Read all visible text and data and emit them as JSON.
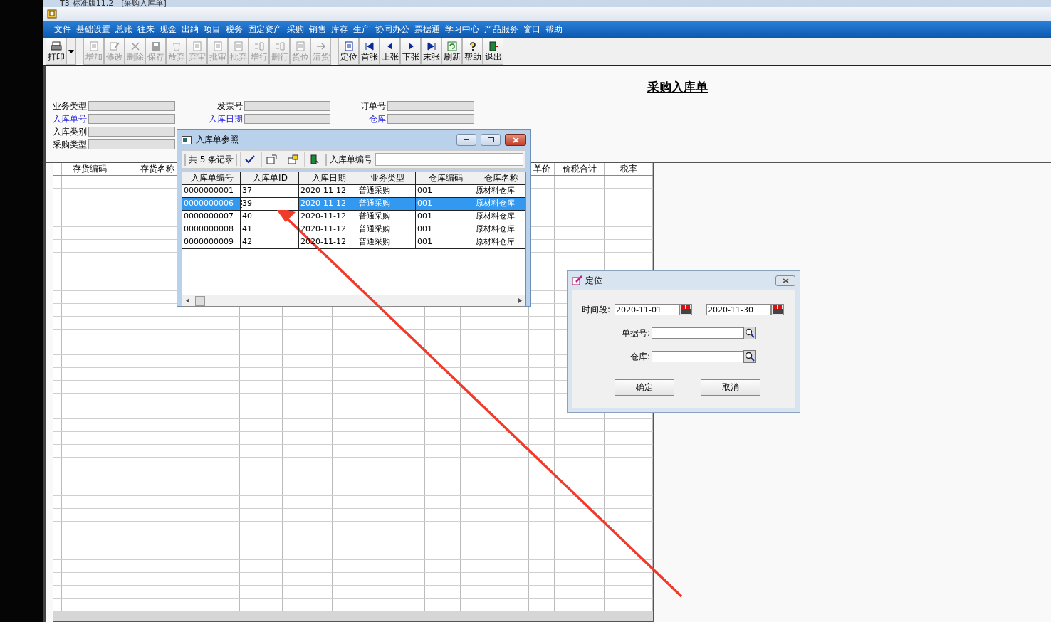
{
  "window": {
    "title": "T3-标准版11.2 - [采购入库单]"
  },
  "menu": [
    "文件",
    "基础设置",
    "总账",
    "往来",
    "现金",
    "出纳",
    "项目",
    "税务",
    "固定资产",
    "采购",
    "销售",
    "库存",
    "生产",
    "协同办公",
    "票据通",
    "学习中心",
    "产品服务",
    "窗口",
    "帮助"
  ],
  "toolbar": {
    "print": {
      "label": "打印"
    },
    "groups": [
      [
        {
          "label": "增加",
          "disabled": true
        },
        {
          "label": "修改",
          "disabled": true
        },
        {
          "label": "删除",
          "disabled": true
        },
        {
          "label": "保存",
          "disabled": true
        },
        {
          "label": "放弃",
          "disabled": true
        },
        {
          "label": "弃审",
          "disabled": true
        },
        {
          "label": "批审",
          "disabled": true
        },
        {
          "label": "批弃",
          "disabled": true
        },
        {
          "label": "增行",
          "disabled": true
        },
        {
          "label": "删行",
          "disabled": true
        },
        {
          "label": "货位",
          "disabled": true
        },
        {
          "label": "清货",
          "disabled": true
        }
      ],
      [
        {
          "label": "定位",
          "disabled": false
        },
        {
          "label": "首张",
          "disabled": false
        },
        {
          "label": "上张",
          "disabled": false
        },
        {
          "label": "下张",
          "disabled": false
        },
        {
          "label": "末张",
          "disabled": false
        },
        {
          "label": "刷新",
          "disabled": false
        },
        {
          "label": "帮助",
          "disabled": false
        },
        {
          "label": "退出",
          "disabled": false
        }
      ]
    ]
  },
  "form": {
    "title": "采购入库单",
    "columns": [
      [
        {
          "label": "业务类型",
          "link": false
        },
        {
          "label": "入库单号",
          "link": true
        },
        {
          "label": "入库类别",
          "link": false
        },
        {
          "label": "采购类型",
          "link": false
        }
      ],
      [
        {
          "label": "发票号",
          "link": false
        },
        {
          "label": "入库日期",
          "link": true
        }
      ],
      [
        {
          "label": "订单号",
          "link": false
        },
        {
          "label": "仓库",
          "link": true
        }
      ]
    ]
  },
  "grid": {
    "columns": [
      "存货编码",
      "存货名称",
      "单价",
      "价税合计",
      "税率"
    ]
  },
  "reference_dialog": {
    "title": "入库单参照",
    "record_count": "共 5 条记录",
    "search_label": "入库单编号",
    "columns": [
      "入库单编号",
      "入库单ID",
      "入库日期",
      "业务类型",
      "仓库编码",
      "仓库名称"
    ],
    "rows": [
      {
        "selected": false,
        "cells": [
          {
            "text": "0000000001",
            "focused": false
          },
          {
            "text": "37",
            "focused": false
          },
          {
            "text": "2020-11-12",
            "focused": false
          },
          {
            "text": "普通采购",
            "focused": false
          },
          {
            "text": "001",
            "focused": false
          },
          {
            "text": "原材料仓库",
            "focused": false
          }
        ]
      },
      {
        "selected": true,
        "cells": [
          {
            "text": "0000000006",
            "focused": false
          },
          {
            "text": "39",
            "focused": true
          },
          {
            "text": "2020-11-12",
            "focused": false
          },
          {
            "text": "普通采购",
            "focused": false
          },
          {
            "text": "001",
            "focused": false
          },
          {
            "text": "原材料仓库",
            "focused": false
          }
        ]
      },
      {
        "selected": false,
        "cells": [
          {
            "text": "0000000007",
            "focused": false
          },
          {
            "text": "40",
            "focused": false
          },
          {
            "text": "2020-11-12",
            "focused": false
          },
          {
            "text": "普通采购",
            "focused": false
          },
          {
            "text": "001",
            "focused": false
          },
          {
            "text": "原材料仓库",
            "focused": false
          }
        ]
      },
      {
        "selected": false,
        "cells": [
          {
            "text": "0000000008",
            "focused": false
          },
          {
            "text": "41",
            "focused": false
          },
          {
            "text": "2020-11-12",
            "focused": false
          },
          {
            "text": "普通采购",
            "focused": false
          },
          {
            "text": "001",
            "focused": false
          },
          {
            "text": "原材料仓库",
            "focused": false
          }
        ]
      },
      {
        "selected": false,
        "cells": [
          {
            "text": "0000000009",
            "focused": false
          },
          {
            "text": "42",
            "focused": false
          },
          {
            "text": "2020-11-12",
            "focused": false
          },
          {
            "text": "普通采购",
            "focused": false
          },
          {
            "text": "001",
            "focused": false
          },
          {
            "text": "原材料仓库",
            "focused": false
          }
        ]
      }
    ]
  },
  "locate_dialog": {
    "title": "定位",
    "period_label": "时间段:",
    "date_from": "2020-11-01",
    "date_to": "2020-11-30",
    "range_separator": "-",
    "number_label": "单据号:",
    "warehouse_label": "仓库:",
    "buttons": [
      "确定",
      "取消"
    ]
  }
}
